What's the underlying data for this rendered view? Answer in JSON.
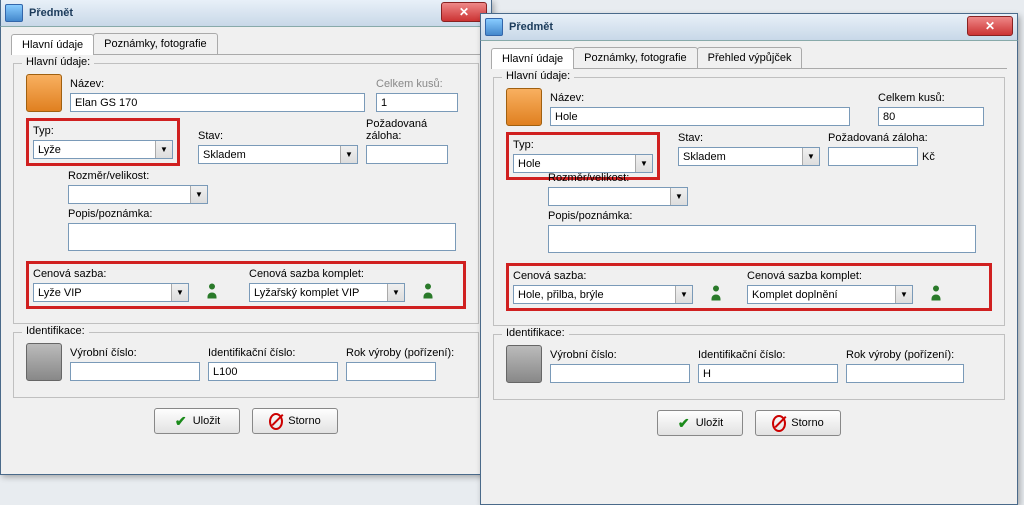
{
  "left": {
    "title": "Předmět",
    "tabs": [
      "Hlavní údaje",
      "Poznámky, fotografie"
    ],
    "group_main": "Hlavní údaje:",
    "nazev_label": "Název:",
    "nazev_value": "Elan GS 170",
    "kusu_label": "Celkem kusů:",
    "kusu_value": "1",
    "typ_label": "Typ:",
    "typ_value": "Lyže",
    "stav_label": "Stav:",
    "stav_value": "Skladem",
    "zaloha_label": "Požadovaná záloha:",
    "zaloha_value": "",
    "rozmer_label": "Rozměr/velikost:",
    "popis_label": "Popis/poznámka:",
    "cenova_label": "Cenová sazba:",
    "cenova_value": "Lyže VIP",
    "cenova_komplet_label": "Cenová sazba komplet:",
    "cenova_komplet_value": "Lyžařský komplet VIP",
    "group_id": "Identifikace:",
    "vyrob_label": "Výrobní číslo:",
    "vyrob_value": "",
    "ident_label": "Identifikační číslo:",
    "ident_value": "L100",
    "rok_label": "Rok výroby (pořízení):",
    "rok_value": "",
    "save": "Uložit",
    "cancel": "Storno"
  },
  "right": {
    "title": "Předmět",
    "tabs": [
      "Hlavní údaje",
      "Poznámky, fotografie",
      "Přehled výpůjček"
    ],
    "group_main": "Hlavní údaje:",
    "nazev_label": "Název:",
    "nazev_value": "Hole",
    "kusu_label": "Celkem kusů:",
    "kusu_value": "80",
    "typ_label": "Typ:",
    "typ_value": "Hole",
    "stav_label": "Stav:",
    "stav_value": "Skladem",
    "zaloha_label": "Požadovaná záloha:",
    "zaloha_value": "",
    "zaloha_unit": "Kč",
    "rozmer_label": "Rozměr/velikost:",
    "popis_label": "Popis/poznámka:",
    "cenova_label": "Cenová sazba:",
    "cenova_value": "Hole, přilba, brýle",
    "cenova_komplet_label": "Cenová sazba komplet:",
    "cenova_komplet_value": "Komplet doplnění",
    "group_id": "Identifikace:",
    "vyrob_label": "Výrobní číslo:",
    "vyrob_value": "",
    "ident_label": "Identifikační číslo:",
    "ident_value": "H",
    "rok_label": "Rok výroby (pořízení):",
    "rok_value": "",
    "save": "Uložit",
    "cancel": "Storno"
  }
}
